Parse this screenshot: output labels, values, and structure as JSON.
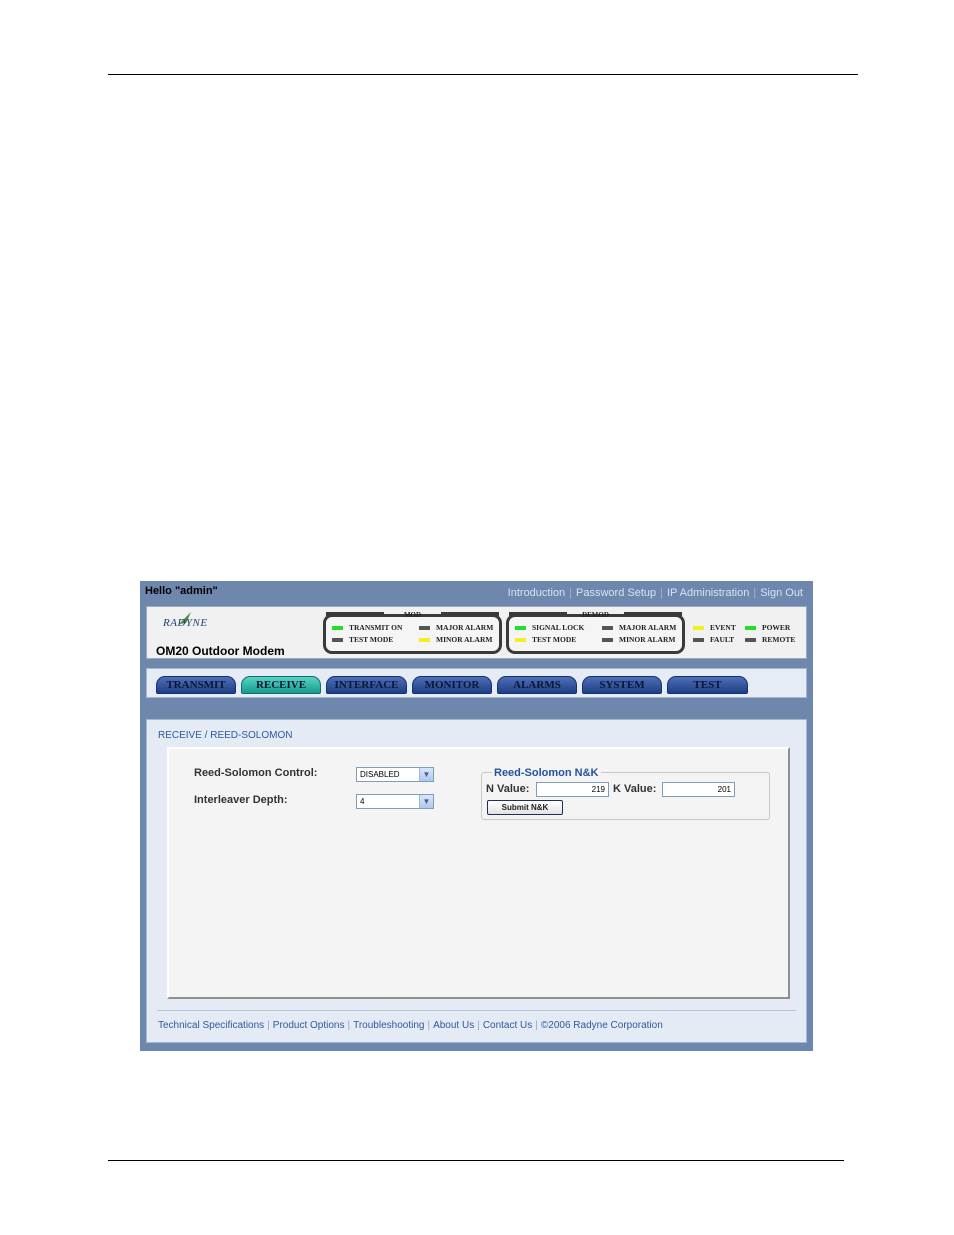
{
  "topbar": {
    "greeting": "Hello \"admin\"",
    "links": [
      "Introduction",
      "Password Setup",
      "IP Administration",
      "Sign Out"
    ]
  },
  "header": {
    "logo_text": "RADYNE",
    "model_title": "OM20 Outdoor Modem",
    "mod": {
      "caption": "MOD",
      "leds": [
        {
          "label": "TRANSMIT ON",
          "color": "#22e02a"
        },
        {
          "label": "TEST MODE",
          "color": "#555555"
        },
        {
          "label": "MAJOR ALARM",
          "color": "#555555"
        },
        {
          "label": "MINOR ALARM",
          "color": "#f2f21a"
        }
      ]
    },
    "demod": {
      "caption": "DEMOD",
      "leds": [
        {
          "label": "SIGNAL LOCK",
          "color": "#22e02a"
        },
        {
          "label": "TEST MODE",
          "color": "#f2f21a"
        },
        {
          "label": "MAJOR ALARM",
          "color": "#555555"
        },
        {
          "label": "MINOR ALARM",
          "color": "#555555"
        }
      ]
    },
    "status_leds": [
      {
        "label": "EVENT",
        "color": "#f2f21a"
      },
      {
        "label": "FAULT",
        "color": "#555555"
      },
      {
        "label": "POWER",
        "color": "#22e02a"
      },
      {
        "label": "REMOTE",
        "color": "#555555"
      }
    ]
  },
  "nav": {
    "tabs": [
      "TRANSMIT",
      "RECEIVE",
      "INTERFACE",
      "MONITOR",
      "ALARMS",
      "SYSTEM",
      "TEST"
    ],
    "active": "RECEIVE"
  },
  "content": {
    "breadcrumb": "RECEIVE / REED-SOLOMON",
    "rs_control_label": "Reed-Solomon Control:",
    "rs_control_value": "DISABLED",
    "interleaver_label": "Interleaver Depth:",
    "interleaver_value": "4",
    "rs_group_title": "Reed-Solomon N&K",
    "n_label": "N Value:",
    "n_value": "219",
    "k_label": "K Value:",
    "k_value": "201",
    "submit_label": "Submit N&K"
  },
  "footer": {
    "links": [
      "Technical Specifications",
      "Product Options",
      "Troubleshooting",
      "About Us",
      "Contact Us",
      "©2006 Radyne Corporation"
    ]
  },
  "colors": {
    "frame": "#6d87ad",
    "active_tab": "#2bb5a6",
    "tab": "#2e4f9c",
    "link": "#2c5aa0"
  }
}
